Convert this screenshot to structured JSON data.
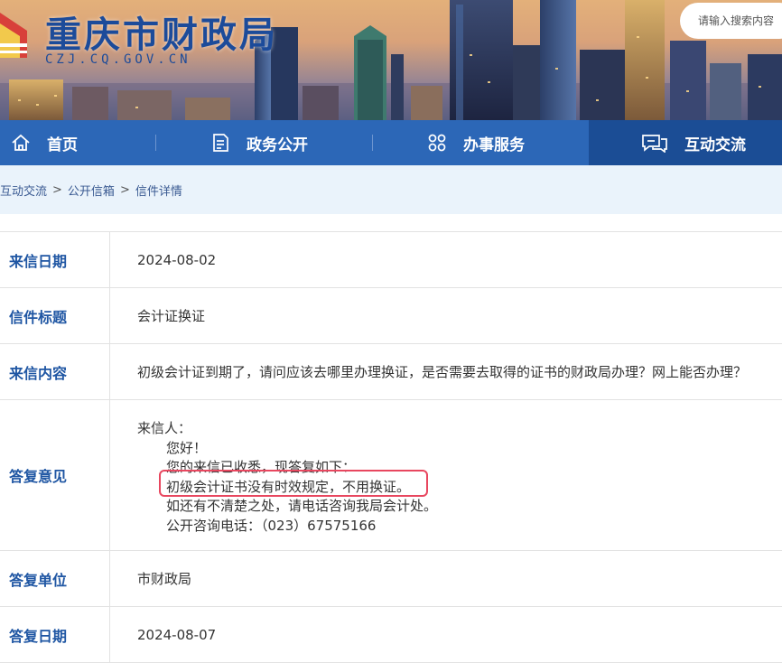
{
  "site": {
    "title": "重庆市财政局",
    "domain": "CZJ.CQ.GOV.CN"
  },
  "search": {
    "placeholder": "请输入搜索内容"
  },
  "nav": {
    "items": [
      {
        "label": "首页",
        "icon": "home-icon"
      },
      {
        "label": "政务公开",
        "icon": "document-icon"
      },
      {
        "label": "办事服务",
        "icon": "grid-icon"
      },
      {
        "label": "互动交流",
        "icon": "chat-icon",
        "active": true
      }
    ]
  },
  "breadcrumb": [
    "互动交流",
    "公开信箱",
    "信件详情"
  ],
  "letter": {
    "date_label": "来信日期",
    "date": "2024-08-02",
    "title_label": "信件标题",
    "title": "会计证换证",
    "content_label": "来信内容",
    "content": "初级会计证到期了，请问应该去哪里办理换证，是否需要去取得的证书的财政局办理？网上能否办理？",
    "reply_label": "答复意见",
    "reply_lines": [
      "来信人：",
      "您好！",
      "您的来信已收悉，现答复如下：",
      "初级会计证书没有时效规定，不用换证。",
      "如还有不清楚之处，请电话咨询我局会计处。",
      "公开咨询电话：（023）67575166"
    ],
    "unit_label": "答复单位",
    "unit": "市财政局",
    "reply_date_label": "答复日期",
    "reply_date": "2024-08-07"
  },
  "colors": {
    "nav_bg": "#2c67b7",
    "nav_active_bg": "#1b4d95",
    "label_text": "#1f56a3",
    "highlight_border": "#e8475f",
    "breadcrumb_bg": "#eaf3fb"
  }
}
